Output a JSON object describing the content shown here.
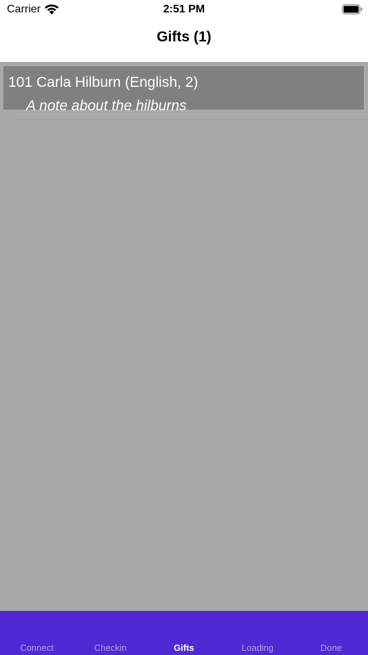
{
  "status_bar": {
    "carrier": "Carrier",
    "time": "2:51 PM",
    "wifi_icon": "wifi-icon",
    "battery_icon": "battery-icon"
  },
  "nav": {
    "title": "Gifts (1)"
  },
  "gifts": [
    {
      "title": "101 Carla Hilburn (English, 2)",
      "note": "A note about the hilburns"
    }
  ],
  "tabs": [
    {
      "label": "Connect",
      "active": false
    },
    {
      "label": "Checkin",
      "active": false
    },
    {
      "label": "Gifts",
      "active": true
    },
    {
      "label": "Loading",
      "active": false
    },
    {
      "label": "Done",
      "active": false
    }
  ],
  "colors": {
    "tab_bar": "#5029d4",
    "content_bg": "#a9a9a9",
    "row_bg": "#808080"
  }
}
